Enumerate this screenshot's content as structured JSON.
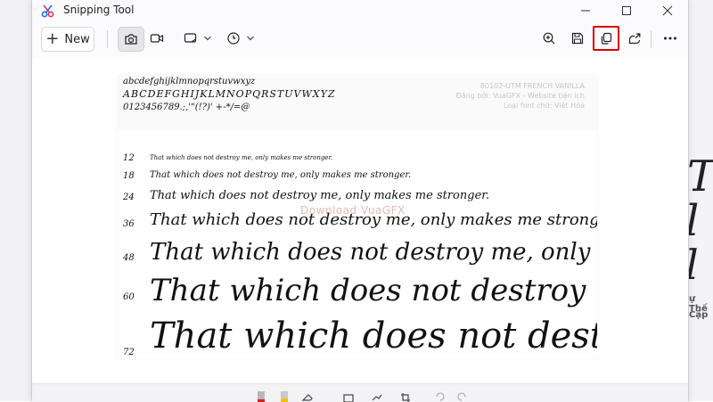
{
  "app": {
    "title": "Snipping Tool"
  },
  "toolbar": {
    "new_label": "New"
  },
  "snip": {
    "glyph_lower": "abcdefghijklmnopqrstuvwxyz",
    "glyph_upper": "ABCDEFGHIJKLMNOPQRSTUVWXYZ",
    "glyph_digits": "0123456789.;,'\"(!?)' +-*/=@",
    "meta_lines": [
      "80102-UTM FRENCH VANILLA",
      "Đăng bởi: VuaGFX - Website tiện ích",
      "Loại font chữ: Việt Hóa"
    ],
    "watermark": "Download VuaGFX",
    "rows": [
      {
        "size": "12",
        "text": "That which does not destroy me, only makes me stronger."
      },
      {
        "size": "18",
        "text": "That which does not destroy me, only makes me stronger."
      },
      {
        "size": "24",
        "text": "That which does not destroy me, only makes me stronger."
      },
      {
        "size": "36",
        "text": "That which does not destroy me, only makes me stronger."
      },
      {
        "size": "48",
        "text": "That which does not destroy me, only makes m"
      },
      {
        "size": "60",
        "text": "That which does not destroy me, only"
      },
      {
        "size": "72",
        "text": "That which does not destroy m"
      }
    ]
  },
  "background_right": {
    "line1": "ự Thế",
    "line2": "Cập"
  },
  "colors": {
    "highlight": "#e00000",
    "accent": "#0067c0"
  }
}
